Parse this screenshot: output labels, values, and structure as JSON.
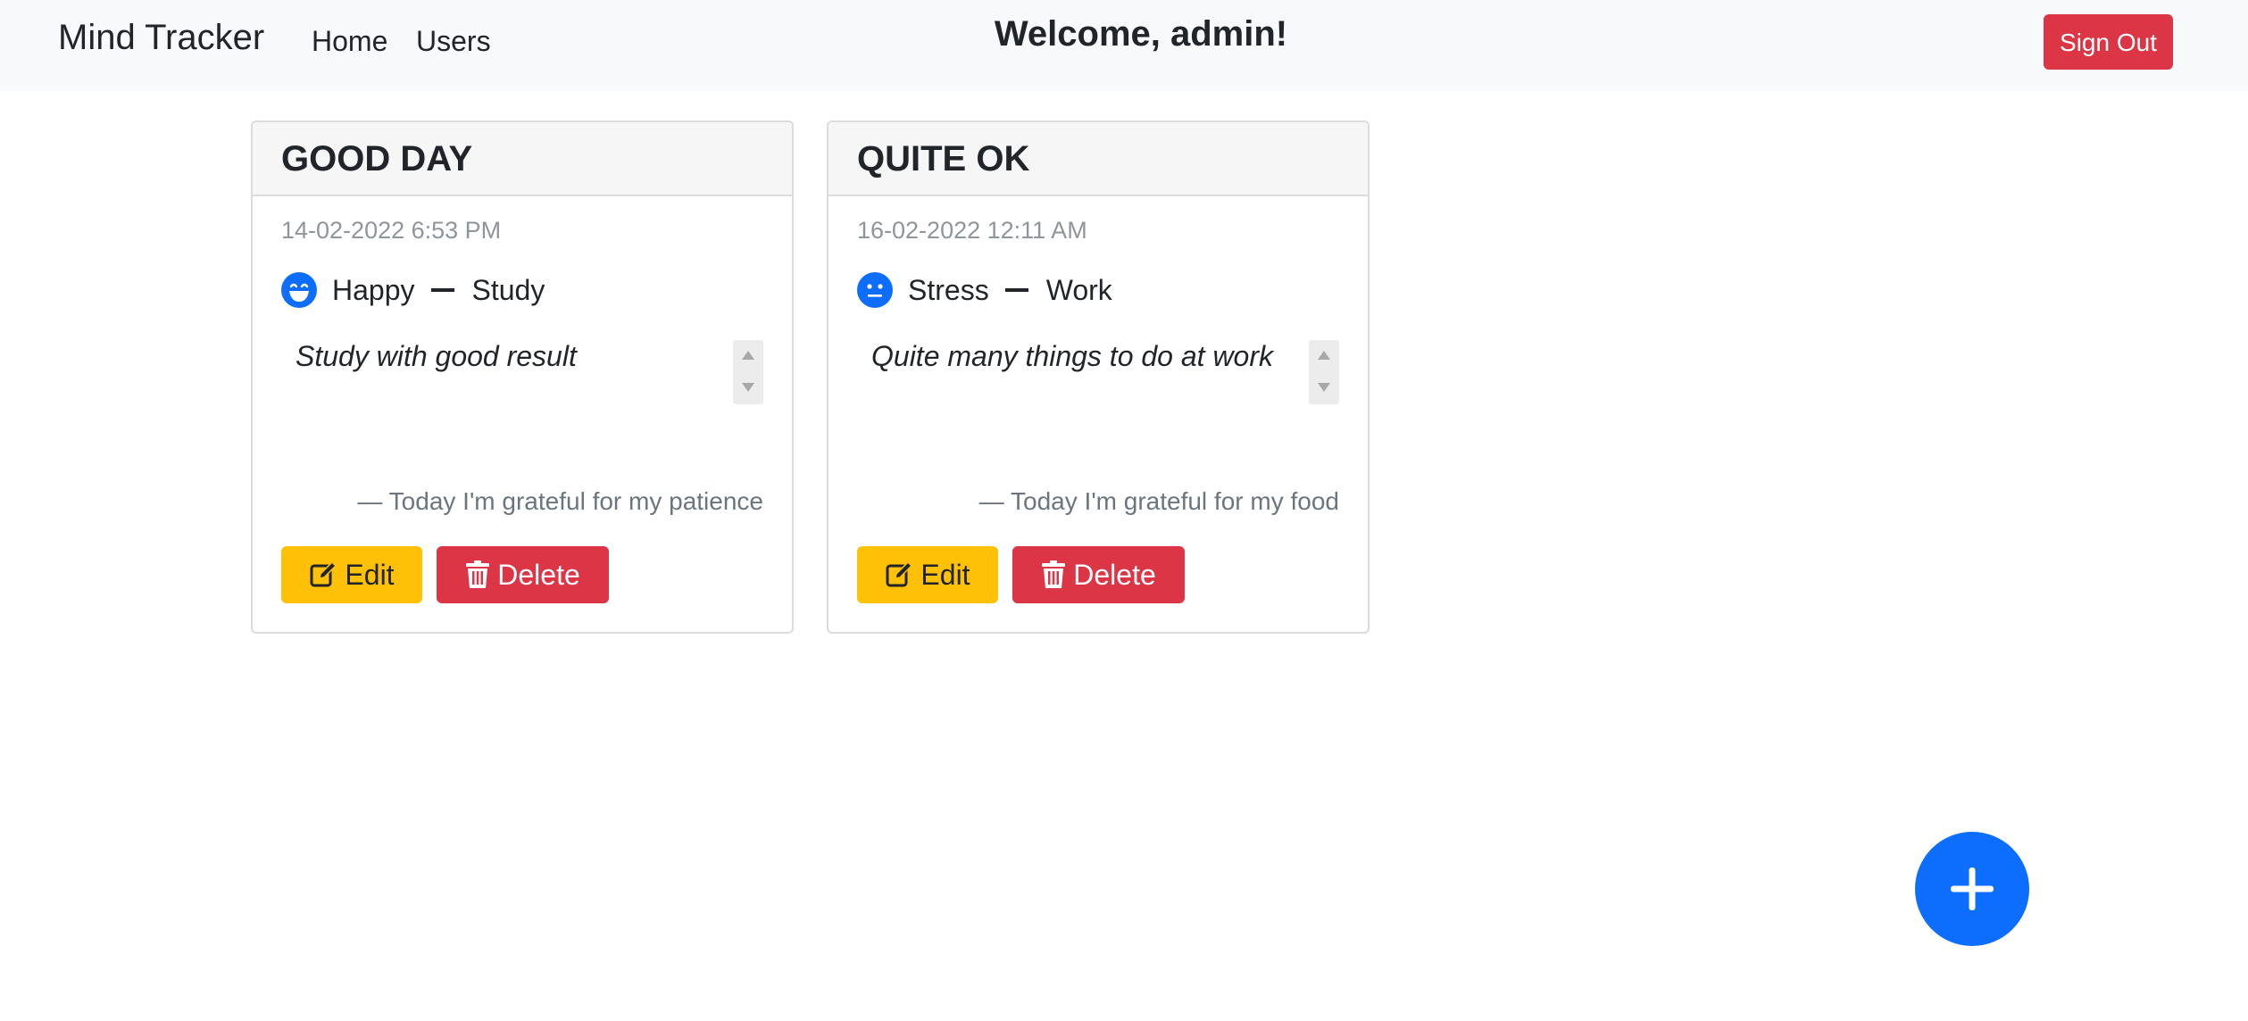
{
  "navbar": {
    "brand": "Mind Tracker",
    "links": [
      "Home",
      "Users"
    ],
    "welcome": "Welcome, admin!",
    "signout_label": "Sign Out"
  },
  "cards": [
    {
      "title": "GOOD DAY",
      "date": "14-02-2022 6:53 PM",
      "mood": "Happy",
      "mood_icon": "grinning-face-icon",
      "activity": "Study",
      "note": "Study with good result",
      "grateful": "— Today I'm grateful for my patience",
      "edit_label": "Edit",
      "delete_label": "Delete"
    },
    {
      "title": "QUITE OK",
      "date": "16-02-2022 12:11 AM",
      "mood": "Stress",
      "mood_icon": "neutral-face-icon",
      "activity": "Work",
      "note": "Quite many things to do at work",
      "grateful": "— Today I'm grateful for my food",
      "edit_label": "Edit",
      "delete_label": "Delete"
    }
  ],
  "fab": {
    "icon": "plus-icon"
  },
  "colors": {
    "navbar_bg": "#f8f9fa",
    "danger": "#dc3545",
    "warning": "#ffc107",
    "primary": "#0d6efd",
    "muted": "#6c757d"
  }
}
